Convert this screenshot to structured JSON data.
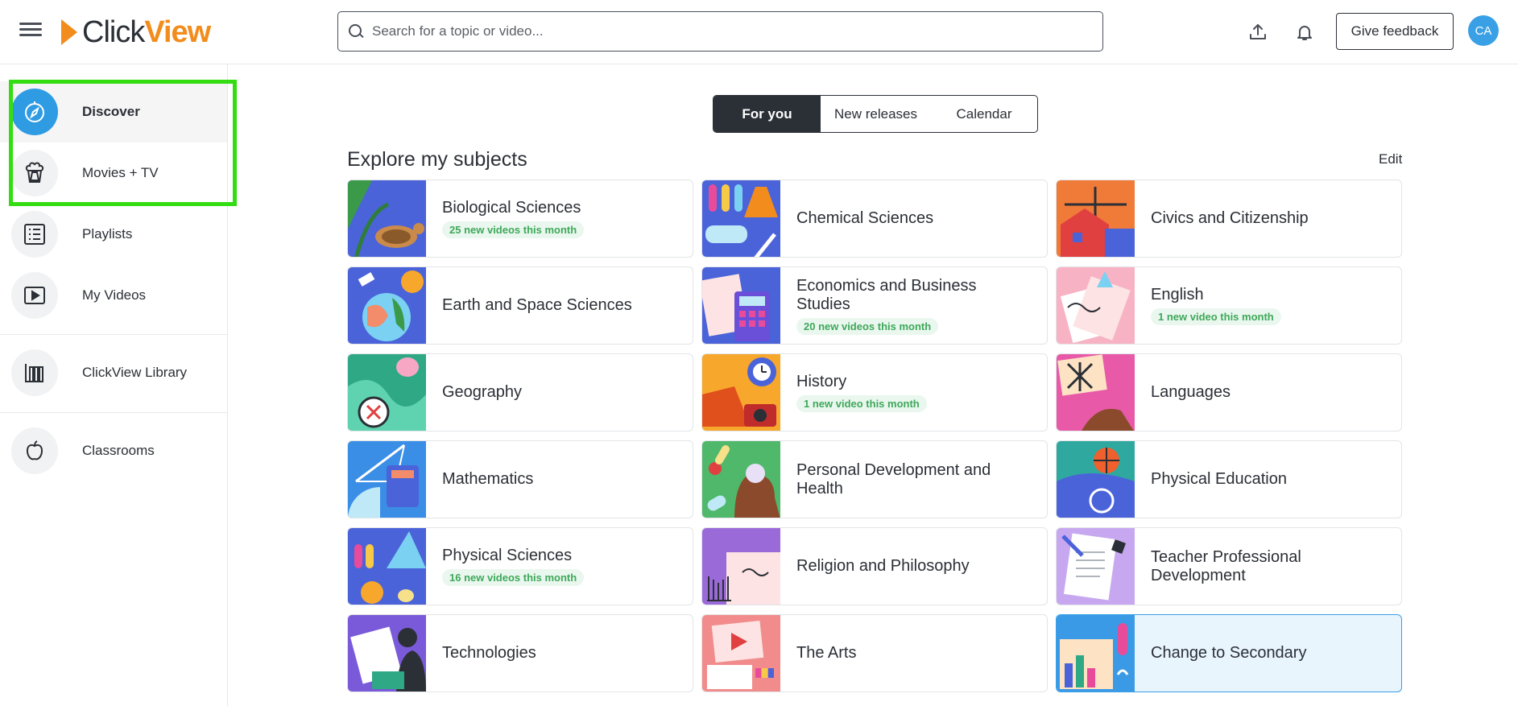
{
  "header": {
    "logo_click": "Click",
    "logo_view": "View",
    "search_placeholder": "Search for a topic or video...",
    "feedback_label": "Give feedback",
    "avatar_initials": "CA"
  },
  "sidebar": {
    "items": [
      {
        "label": "Discover",
        "icon": "compass-icon"
      },
      {
        "label": "Movies + TV",
        "icon": "popcorn-icon"
      },
      {
        "label": "Playlists",
        "icon": "list-icon"
      },
      {
        "label": "My Videos",
        "icon": "play-icon"
      },
      {
        "label": "ClickView Library",
        "icon": "library-icon"
      },
      {
        "label": "Classrooms",
        "icon": "apple-icon"
      }
    ]
  },
  "tabs": [
    "For you",
    "New releases",
    "Calendar"
  ],
  "main": {
    "section_title": "Explore my subjects",
    "edit_label": "Edit"
  },
  "subjects": [
    {
      "title": "Biological Sciences",
      "badge": "25 new videos this month"
    },
    {
      "title": "Chemical Sciences",
      "badge": ""
    },
    {
      "title": "Civics and Citizenship",
      "badge": ""
    },
    {
      "title": "Earth and Space Sciences",
      "badge": ""
    },
    {
      "title": "Economics and Business Studies",
      "badge": "20 new videos this month"
    },
    {
      "title": "English",
      "badge": "1 new video this month"
    },
    {
      "title": "Geography",
      "badge": ""
    },
    {
      "title": "History",
      "badge": "1 new video this month"
    },
    {
      "title": "Languages",
      "badge": ""
    },
    {
      "title": "Mathematics",
      "badge": ""
    },
    {
      "title": "Personal Development and Health",
      "badge": ""
    },
    {
      "title": "Physical Education",
      "badge": ""
    },
    {
      "title": "Physical Sciences",
      "badge": "16 new videos this month"
    },
    {
      "title": "Religion and Philosophy",
      "badge": ""
    },
    {
      "title": "Teacher Professional Development",
      "badge": ""
    },
    {
      "title": "Technologies",
      "badge": ""
    },
    {
      "title": "The Arts",
      "badge": ""
    },
    {
      "title": "Change to Secondary",
      "badge": ""
    }
  ],
  "colors": {
    "brand_orange": "#f28c1c",
    "accent_blue": "#2f9be3",
    "badge_green": "#3ea85a",
    "highlight_green": "#33dd11",
    "tab_active": "#2b2f36"
  }
}
